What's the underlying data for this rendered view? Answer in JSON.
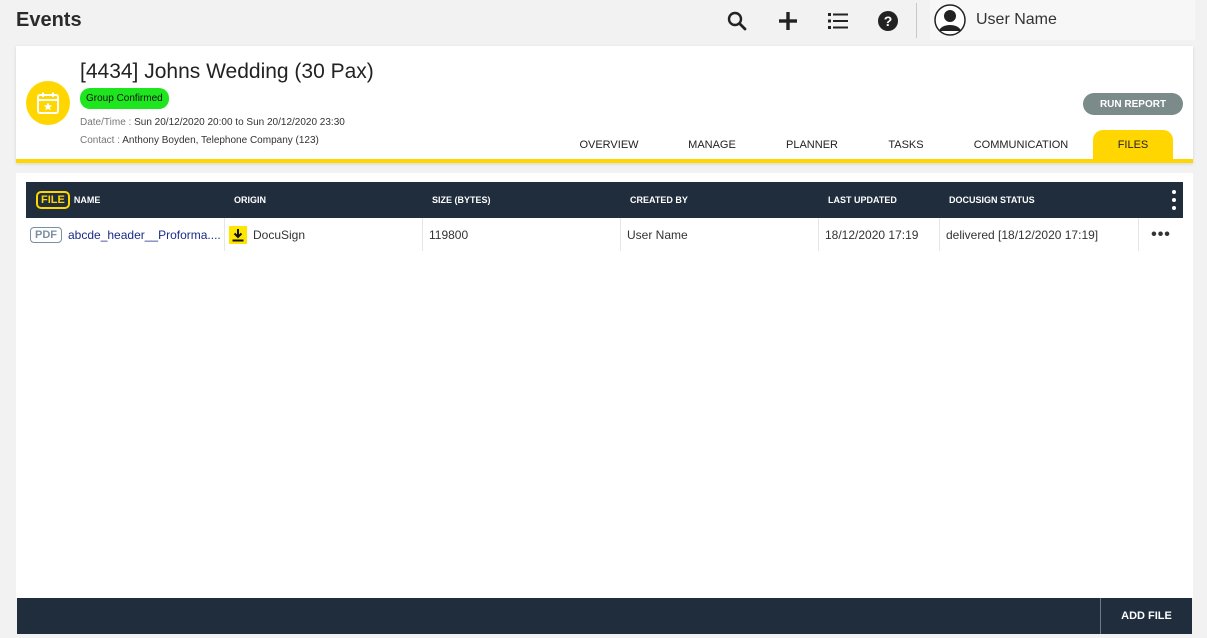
{
  "app": {
    "title": "Events"
  },
  "topbar": {
    "icons": [
      "search-icon",
      "plus-icon",
      "list-icon",
      "help-icon"
    ],
    "user_name": "User Name"
  },
  "event": {
    "title": "[4434] Johns Wedding (30 Pax)",
    "status": "Group Confirmed",
    "date_label": "Date/Time :",
    "date_value": "Sun 20/12/2020 20:00 to Sun 20/12/2020 23:30",
    "contact_label": "Contact :",
    "contact_value": "Anthony Boyden, Telephone Company (123)",
    "run_report_label": "RUN REPORT"
  },
  "tabs": [
    {
      "label": "OVERVIEW"
    },
    {
      "label": "MANAGE"
    },
    {
      "label": "PLANNER"
    },
    {
      "label": "TASKS"
    },
    {
      "label": "COMMUNICATION"
    },
    {
      "label": "FILES",
      "active": true
    }
  ],
  "files_table": {
    "file_badge": "FILE",
    "columns": [
      "NAME",
      "ORIGIN",
      "SIZE (BYTES)",
      "CREATED BY",
      "LAST UPDATED",
      "DOCUSIGN STATUS"
    ],
    "rows": [
      {
        "type_badge": "PDF",
        "name": "abcde_header__Proforma....",
        "origin": "DocuSign",
        "size": "119800",
        "created_by": "User Name",
        "last_updated": "18/12/2020 17:19",
        "docusign_status": "delivered [18/12/2020 17:19]"
      }
    ]
  },
  "footer": {
    "add_file_label": "ADD FILE"
  },
  "colors": {
    "accent": "#ffd600",
    "status_green": "#1ee61e",
    "header_dark": "#1f2d3d",
    "button_gray": "#7b8b8a"
  }
}
